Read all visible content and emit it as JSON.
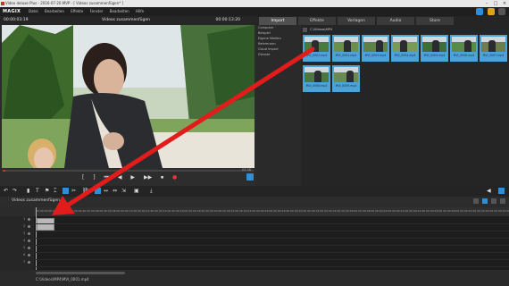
{
  "window": {
    "title": "Video deluxe Plus - 2016-07-20.MVP - [ Videos zusammenfügen* ]",
    "controls": [
      "–",
      "□",
      "×"
    ]
  },
  "menubar": {
    "logo": "MAGIX",
    "items": [
      "Datei",
      "Bearbeiten",
      "Effekte",
      "Fenster",
      "Bearbeiten",
      "Hilfe"
    ]
  },
  "monitor": {
    "timecode_left": "00:00:03:19",
    "title": "Videos zusammenfügen",
    "timecode_right": "00:00:13:20",
    "timecode_small": "03:38",
    "playback_progress": 0.01
  },
  "transport": {
    "buttons": [
      "[",
      "]",
      "⏮",
      "◀",
      "▶",
      "▶▶",
      "⏹",
      "●"
    ]
  },
  "mediapool": {
    "tabs": [
      "Import",
      "Effekte",
      "Vorlagen",
      "Audio",
      "Store"
    ],
    "active_tab": "Import",
    "folders": [
      "Computer",
      "Beispiel",
      "Eigene Medien",
      "Referenzen",
      "Cloud Import",
      "Dienste"
    ],
    "path": "C:\\Videos\\MP4",
    "thumbs": [
      {
        "label": "MVI_0001.mp4"
      },
      {
        "label": "MVI_0002.mp4"
      },
      {
        "label": "MVI_0003.mp4"
      },
      {
        "label": "MVI_0004.mp4"
      },
      {
        "label": "MVI_0005.mp4"
      },
      {
        "label": "MVI_0006.mp4"
      },
      {
        "label": "MVI_0007.mp4"
      },
      {
        "label": "MVI_0008.mp4"
      },
      {
        "label": "MVI_0009.mp4"
      }
    ]
  },
  "timeline": {
    "name": "Videos zusammenfügen",
    "ruler": [
      "00:00:00:00",
      "00:00:02:00",
      "00:00:04:00",
      "00:00:06:00",
      "00:00:08:00",
      "00:00:10:00",
      "00:00:12:00",
      "00:00:14:00",
      "00:00:16:00",
      "00:00:18:00",
      "00:00:20:00",
      "00:00:22:00",
      "00:00:24:00",
      "00:00:26:00",
      "00:00:28:00",
      "00:00:30:00",
      "00:00:32:00",
      "00:00:34:00",
      "00:00:36:00",
      "00:00:38:00",
      "00:00:40:00",
      "00:00:42:00",
      "00:00:44:00",
      "00:00:46:00",
      "00:00:48:00",
      "00:00:50:00",
      "00:00:52:00",
      "00:00:54:00"
    ],
    "tracks": [
      "1",
      "2",
      "3",
      "4",
      "5",
      "6",
      "7"
    ]
  },
  "status": {
    "text": "C:\\Videos\\MP4\\MVI_0001.mp4"
  },
  "colors": {
    "accent": "#2f8fd6",
    "thumb_bg": "#4ba3d8",
    "arrow": "#e21b1b"
  }
}
